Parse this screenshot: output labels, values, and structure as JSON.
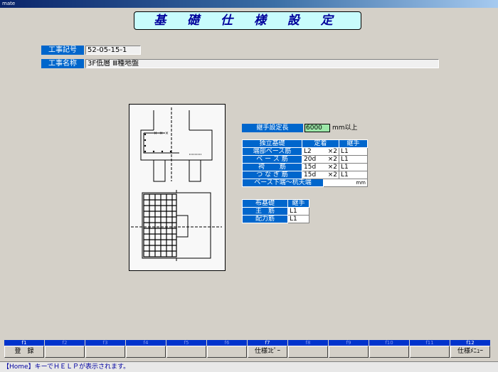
{
  "window": {
    "title": "mate"
  },
  "screen_title": "基 礎 仕 様 設 定",
  "project": {
    "number_label": "工事記号",
    "number_value": "52-05-15-1",
    "name_label": "工事名称",
    "name_value": "3F低層 Ⅲ種地盤"
  },
  "joint_setting": {
    "label": "継手設定長",
    "value": "6000",
    "unit": "mm以上"
  },
  "independent_footing": {
    "headers": [
      "独立基礎",
      "定着",
      "継手"
    ],
    "rows": [
      {
        "label": "端部ベース筋",
        "anchor": "L2",
        "mult": "×2",
        "joint": "L1"
      },
      {
        "label": "ベ ー ス 筋",
        "anchor": "20d",
        "mult": "×2",
        "joint": "L1"
      },
      {
        "label": "袴　　 筋",
        "anchor": "15d",
        "mult": "×2",
        "joint": "L1"
      },
      {
        "label": "つ な ぎ 筋",
        "anchor": "15d",
        "mult": "×2",
        "joint": "L1"
      }
    ],
    "base_bottom_label": "ベース下端～杭天端",
    "base_bottom_value": "",
    "base_bottom_unit": "mm"
  },
  "mat_footing": {
    "headers": [
      "布基礎",
      "継手"
    ],
    "rows": [
      {
        "label": "主　筋",
        "joint": "L1"
      },
      {
        "label": "配力筋",
        "joint": "L1"
      }
    ]
  },
  "function_keys": [
    {
      "key": "f1",
      "label": "登　録",
      "active": true
    },
    {
      "key": "f2",
      "label": "",
      "active": false
    },
    {
      "key": "f3",
      "label": "",
      "active": false
    },
    {
      "key": "f4",
      "label": "",
      "active": false
    },
    {
      "key": "f5",
      "label": "",
      "active": false
    },
    {
      "key": "f6",
      "label": "",
      "active": false
    },
    {
      "key": "f7",
      "label": "仕様ｺﾋﾟｰ",
      "active": true
    },
    {
      "key": "f8",
      "label": "",
      "active": false
    },
    {
      "key": "f9",
      "label": "",
      "active": false
    },
    {
      "key": "f10",
      "label": "",
      "active": false
    },
    {
      "key": "f11",
      "label": "",
      "active": false
    },
    {
      "key": "f12",
      "label": "仕様ﾒﾆｭｰ",
      "active": true
    }
  ],
  "status_bar": {
    "message": "【Home】キーでＨＥＬＰが表示されます。"
  },
  "colors": {
    "label_bg": "#0066cc",
    "title_bg": "#c8fcfc",
    "title_text": "#00009c",
    "highlight_input": "#9ce7a8"
  }
}
